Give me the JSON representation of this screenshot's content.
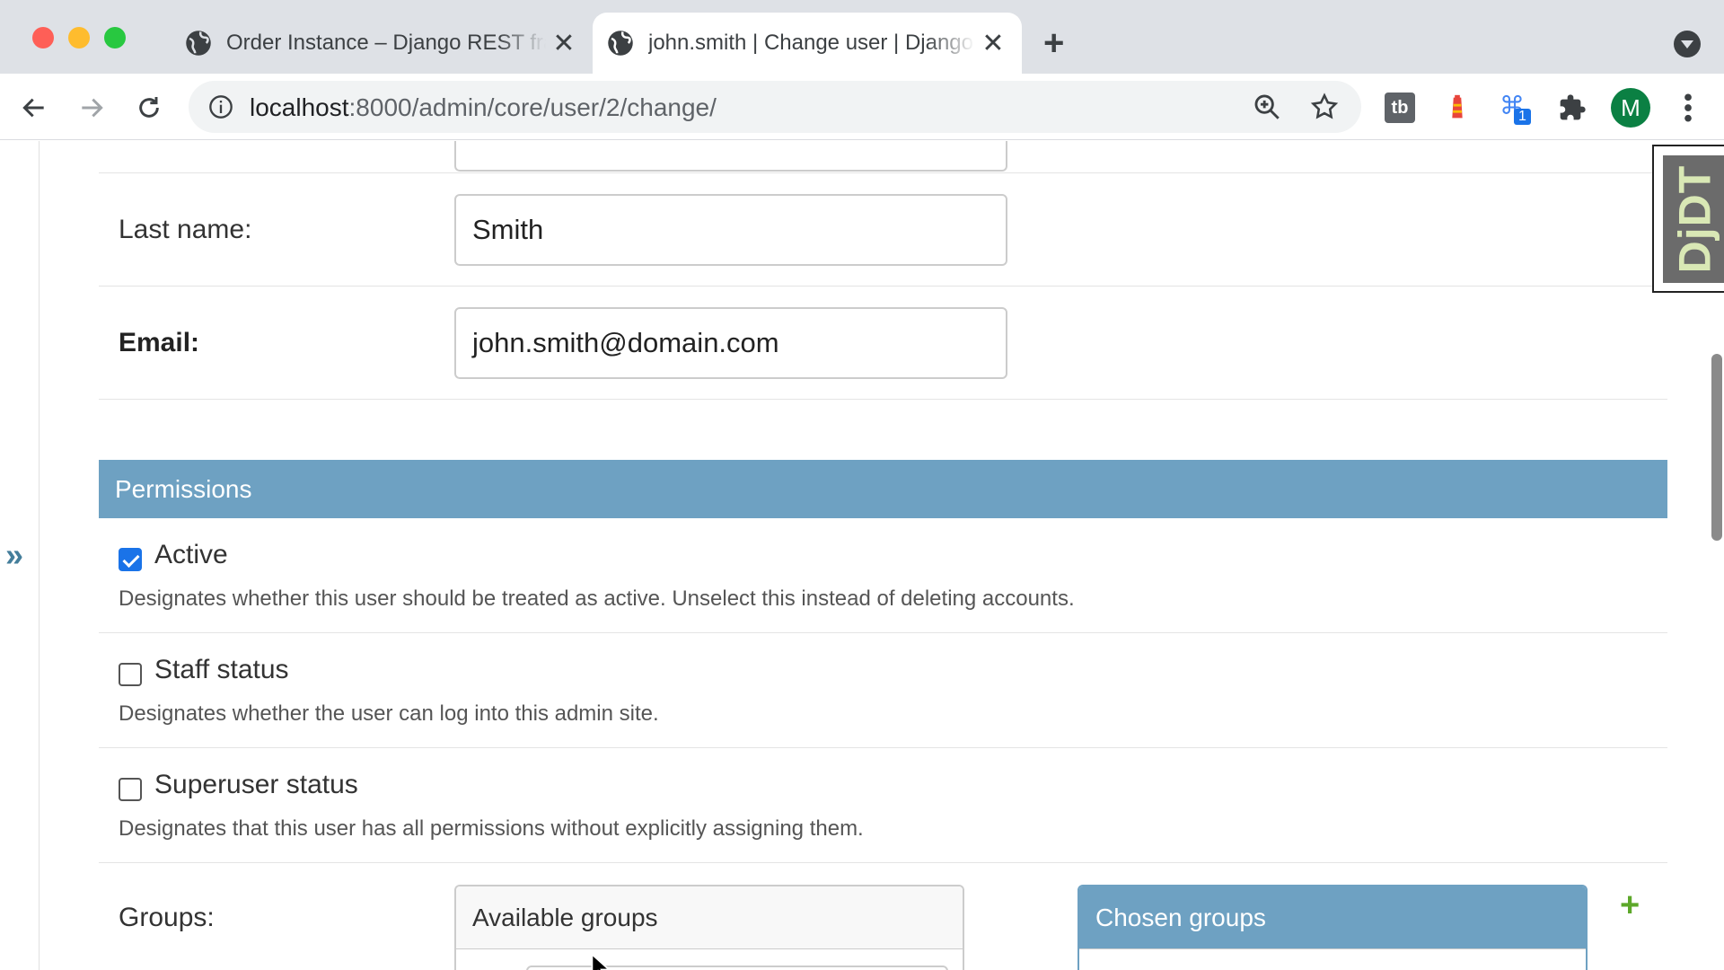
{
  "browser": {
    "tabs": [
      {
        "title": "Order Instance – Django REST framework",
        "active": false
      },
      {
        "title": "john.smith | Change user | Django site admin",
        "active": true
      }
    ],
    "url_host": "localhost",
    "url_path": ":8000/admin/core/user/2/change/",
    "profile_initial": "M",
    "extension_badge": "1",
    "accent_color": "#1a73e8"
  },
  "form": {
    "last_name": {
      "label": "Last name:",
      "value": "Smith"
    },
    "email": {
      "label": "Email:",
      "value": "john.smith@domain.com"
    }
  },
  "permissions": {
    "caption": "Permissions",
    "header_color": "#6ea1c2",
    "active": {
      "label": "Active",
      "checked": true,
      "help": "Designates whether this user should be treated as active. Unselect this instead of deleting accounts."
    },
    "staff": {
      "label": "Staff status",
      "checked": false,
      "help": "Designates whether the user can log into this admin site."
    },
    "superuser": {
      "label": "Superuser status",
      "checked": false,
      "help": "Designates that this user has all permissions without explicitly assigning them."
    },
    "groups": {
      "label": "Groups:",
      "available_title": "Available groups",
      "chosen_title": "Chosen groups",
      "add_icon": "+"
    }
  },
  "sidebar": {
    "toggle": "»"
  },
  "debug_toolbar": {
    "label": "DjDT"
  }
}
